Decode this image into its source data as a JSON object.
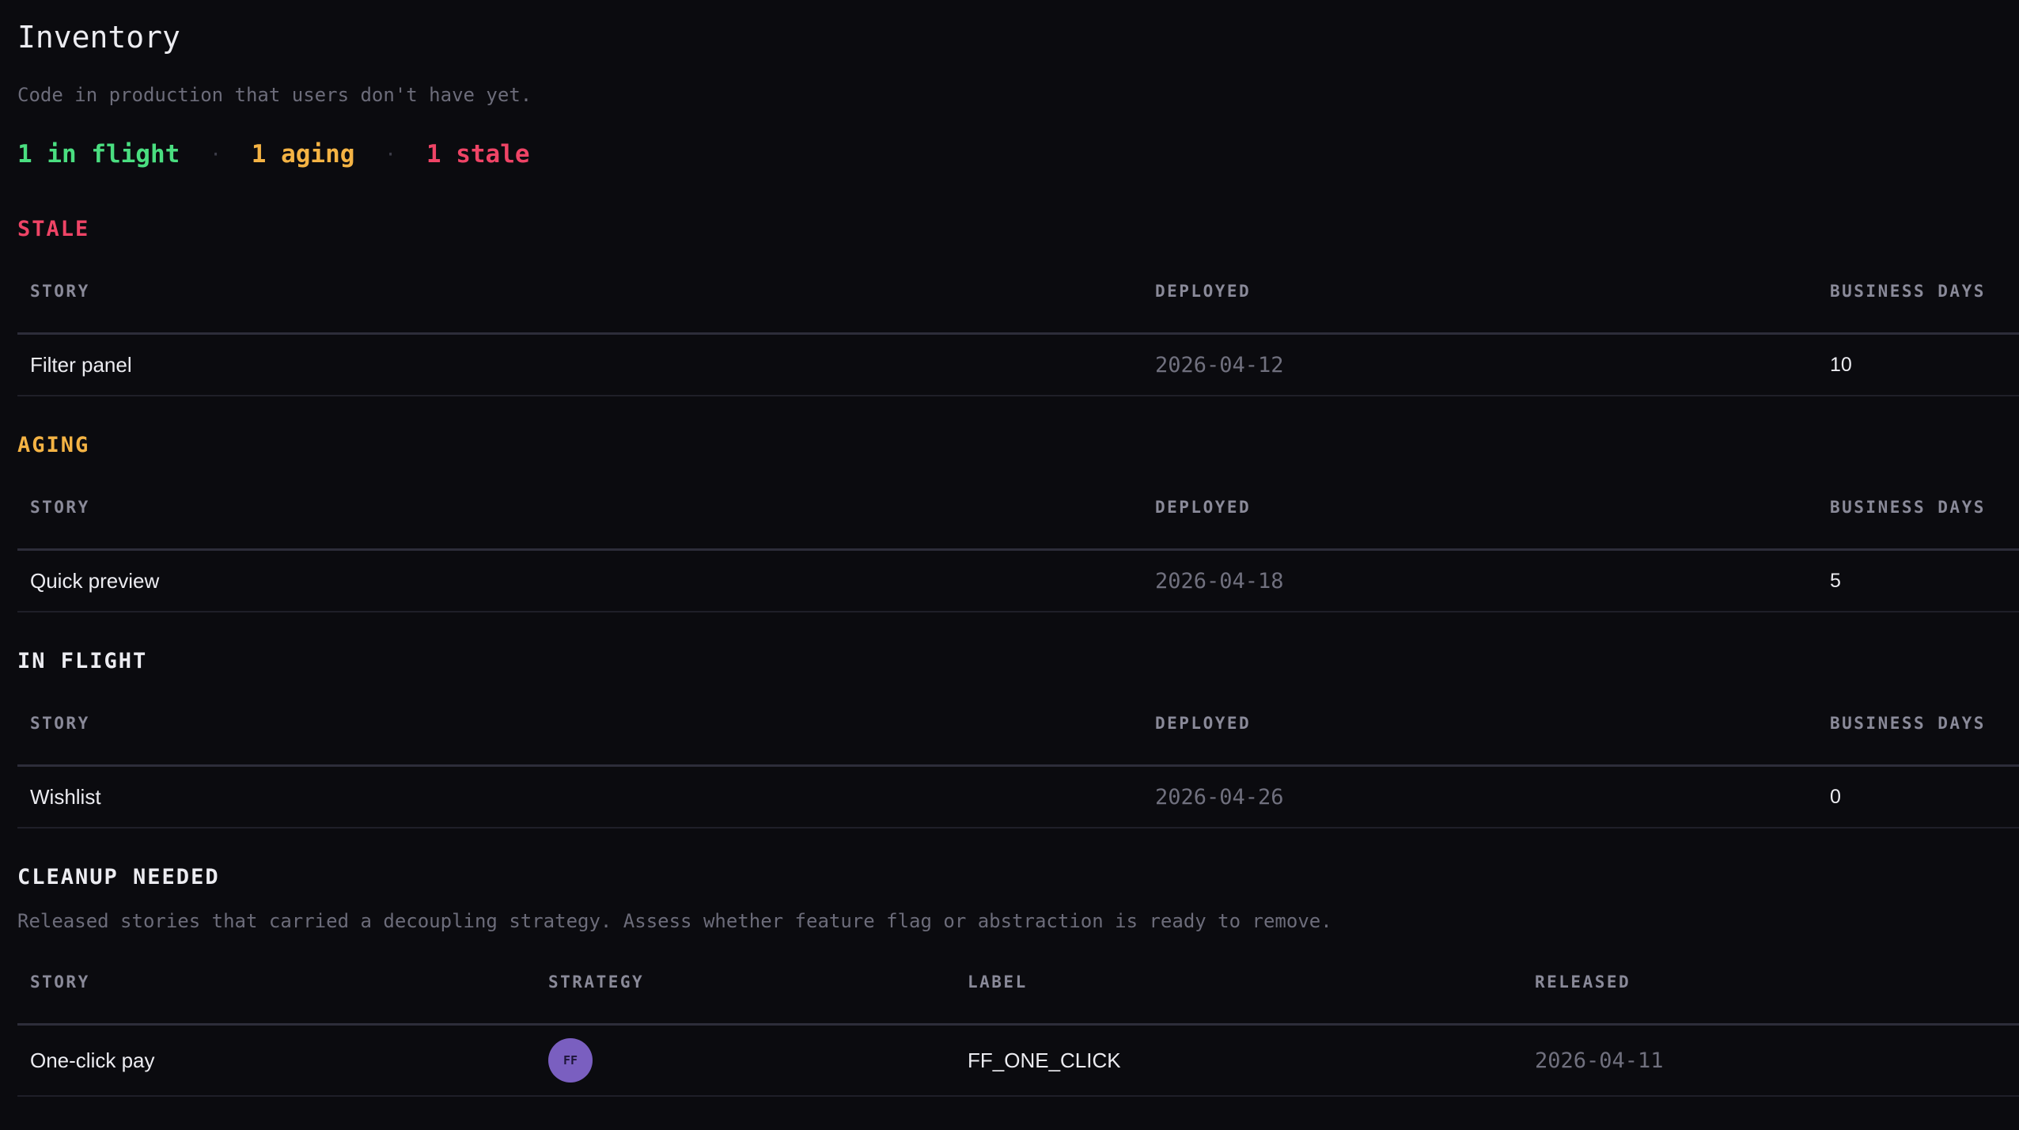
{
  "page": {
    "title": "Inventory",
    "subtitle": "Code in production that users don't have yet."
  },
  "summary": {
    "in_flight": "1 in flight",
    "aging": "1 aging",
    "stale": "1 stale",
    "separator": "·"
  },
  "colors": {
    "background": "#0b0b0f",
    "in_flight": "#4ade80",
    "aging": "#f4b344",
    "stale": "#ef4466",
    "badge": "#7a5fc0"
  },
  "sections": {
    "stale": {
      "title": "STALE",
      "columns": [
        "STORY",
        "DEPLOYED",
        "BUSINESS DAYS"
      ],
      "rows": [
        {
          "story": "Filter panel",
          "deployed": "2026-04-12",
          "business_days": "10"
        }
      ]
    },
    "aging": {
      "title": "AGING",
      "columns": [
        "STORY",
        "DEPLOYED",
        "BUSINESS DAYS"
      ],
      "rows": [
        {
          "story": "Quick preview",
          "deployed": "2026-04-18",
          "business_days": "5"
        }
      ]
    },
    "in_flight": {
      "title": "IN FLIGHT",
      "columns": [
        "STORY",
        "DEPLOYED",
        "BUSINESS DAYS"
      ],
      "rows": [
        {
          "story": "Wishlist",
          "deployed": "2026-04-26",
          "business_days": "0"
        }
      ]
    },
    "cleanup": {
      "title": "CLEANUP NEEDED",
      "description": "Released stories that carried a decoupling strategy. Assess whether feature flag or abstraction is ready to remove.",
      "columns": [
        "STORY",
        "STRATEGY",
        "LABEL",
        "RELEASED"
      ],
      "rows": [
        {
          "story": "One-click pay",
          "strategy": "FF",
          "label": "FF_ONE_CLICK",
          "released": "2026-04-11"
        }
      ]
    }
  }
}
